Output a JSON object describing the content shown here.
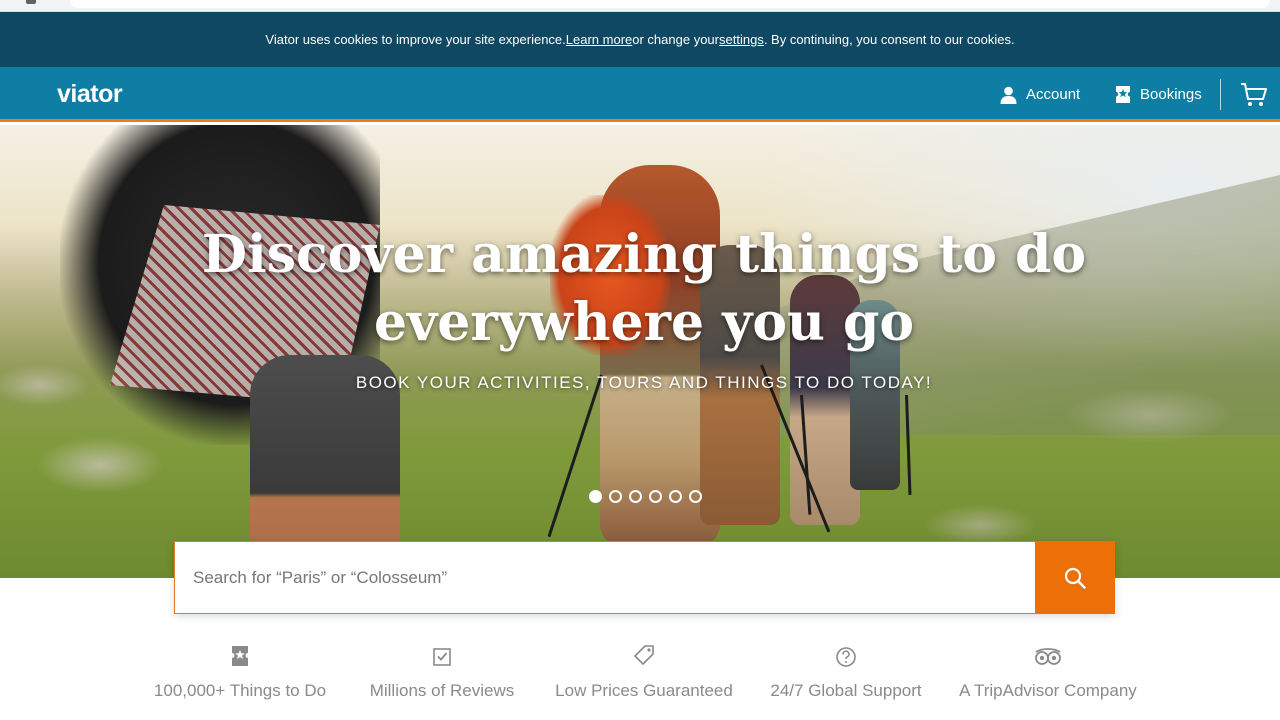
{
  "cookie_banner": {
    "text_before": "Viator uses cookies to improve your site experience. ",
    "learn_more": "Learn more",
    "text_middle": " or change your ",
    "settings": "settings",
    "text_after": ". By continuing, you consent to our cookies."
  },
  "header": {
    "logo": "viator",
    "account_label": "Account",
    "bookings_label": "Bookings",
    "account_icon": "user-icon",
    "bookings_icon": "ticket-icon",
    "cart_icon": "cart-icon"
  },
  "hero": {
    "title_line1": "Discover amazing things to do",
    "title_line2": "everywhere you go",
    "subtitle": "BOOK YOUR ACTIVITIES, TOURS AND THINGS TO DO TODAY!",
    "carousel_slides": 6,
    "carousel_active": 1
  },
  "search": {
    "placeholder": "Search for “Paris” or “Colosseum”",
    "button_icon": "search-icon"
  },
  "features": [
    {
      "label": "100,000+ Things to Do",
      "icon": "ticket-icon"
    },
    {
      "label": "Millions of Reviews",
      "icon": "checkbox-icon"
    },
    {
      "label": "Low Prices Guaranteed",
      "icon": "price-tag-icon"
    },
    {
      "label": "24/7 Global Support",
      "icon": "help-circle-icon"
    },
    {
      "label": "A TripAdvisor Company",
      "icon": "owl-icon"
    }
  ],
  "colors": {
    "cookie_bg": "#0e4862",
    "nav_bg": "#0f7ea5",
    "accent_orange": "#ec6f08",
    "feature_text": "#8a8a8a"
  }
}
